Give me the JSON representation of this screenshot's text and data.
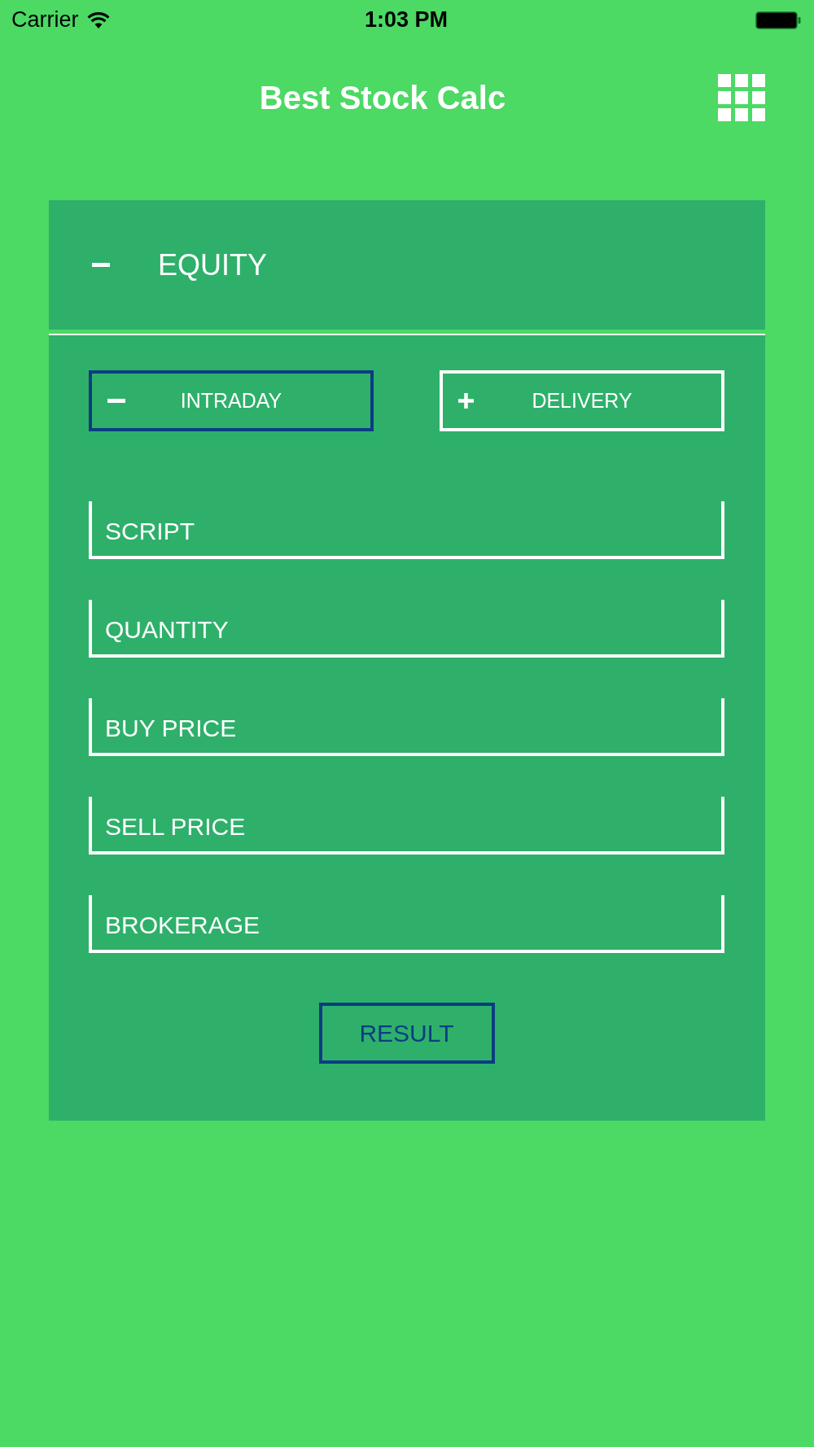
{
  "status_bar": {
    "carrier": "Carrier",
    "time": "1:03 PM"
  },
  "header": {
    "title": "Best Stock Calc"
  },
  "section": {
    "title": "EQUITY",
    "expanded": true
  },
  "tabs": [
    {
      "label": "INTRADAY",
      "selected": true
    },
    {
      "label": "DELIVERY",
      "selected": false
    }
  ],
  "fields": [
    {
      "placeholder": "SCRIPT"
    },
    {
      "placeholder": "QUANTITY"
    },
    {
      "placeholder": "BUY PRICE"
    },
    {
      "placeholder": "SELL PRICE"
    },
    {
      "placeholder": "BROKERAGE"
    }
  ],
  "result_button": {
    "label": "RESULT"
  }
}
